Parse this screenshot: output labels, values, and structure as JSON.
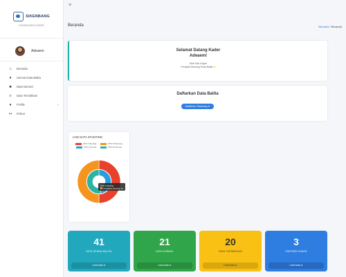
{
  "brand": {
    "name": "SIKENBANG",
    "subtitle": "DASHBOARD KADER"
  },
  "user": {
    "name": "Adeaem"
  },
  "sidebar": {
    "items": [
      {
        "label": "Beranda",
        "icon": "home-icon"
      },
      {
        "label": "Semua Data Balita",
        "icon": "user-icon"
      },
      {
        "label": "Data Normal",
        "icon": "card-icon"
      },
      {
        "label": "Data Terindikasi",
        "icon": "chart-icon"
      },
      {
        "label": "Profile",
        "icon": "users-icon"
      },
      {
        "label": "Keluar",
        "icon": "logout-icon"
      }
    ]
  },
  "header": {
    "title": "Beranda",
    "breadcrumb_home": "Beranda",
    "breadcrumb_sep": "/",
    "breadcrumb_current": "Beranda"
  },
  "welcome": {
    "title": "Selamat Datang Kader",
    "name": "Adeaem!",
    "line1": "Mari Kita Cegah",
    "line2": "Penyakit Stunting Pada Balita"
  },
  "register": {
    "title": "Daftarkan Data Balita",
    "button": "Daftarkan Sekarang"
  },
  "chart": {
    "title": "LIVE DATA STUNTING",
    "legend": [
      {
        "label": "PKK 4 Stunting",
        "color": "#e8412c"
      },
      {
        "label": "PKK 15 Stunting",
        "color": "#f7941d"
      },
      {
        "label": "PKK 4 Normal",
        "color": "#2b9ddb"
      },
      {
        "label": "PKK 15 Normal",
        "color": "#2bb3a4"
      }
    ],
    "tooltip_title": "PKK 4 Stunting",
    "tooltip_value": "Terindikasi Stunting: 10"
  },
  "chart_data": {
    "type": "pie",
    "title": "LIVE DATA STUNTING",
    "series": [
      {
        "name": "PKK 4 Stunting",
        "values": [
          10
        ]
      },
      {
        "name": "PKK 15 Stunting",
        "values": [
          10
        ]
      },
      {
        "name": "PKK 4 Normal",
        "values": [
          10
        ]
      },
      {
        "name": "PKK 15 Normal",
        "values": [
          11
        ]
      }
    ],
    "legend": "top"
  },
  "stats": [
    {
      "value": "41",
      "label": "DATA SEMUA BALITA",
      "link": "Lihat Data"
    },
    {
      "value": "21",
      "label": "DATA NORMAL",
      "link": "Lihat Data"
    },
    {
      "value": "20",
      "label": "DATA TERINDIKASI",
      "link": "Lihat Data"
    },
    {
      "value": "3",
      "label": "PARTNER KADER",
      "link": "Lihat Data"
    }
  ]
}
